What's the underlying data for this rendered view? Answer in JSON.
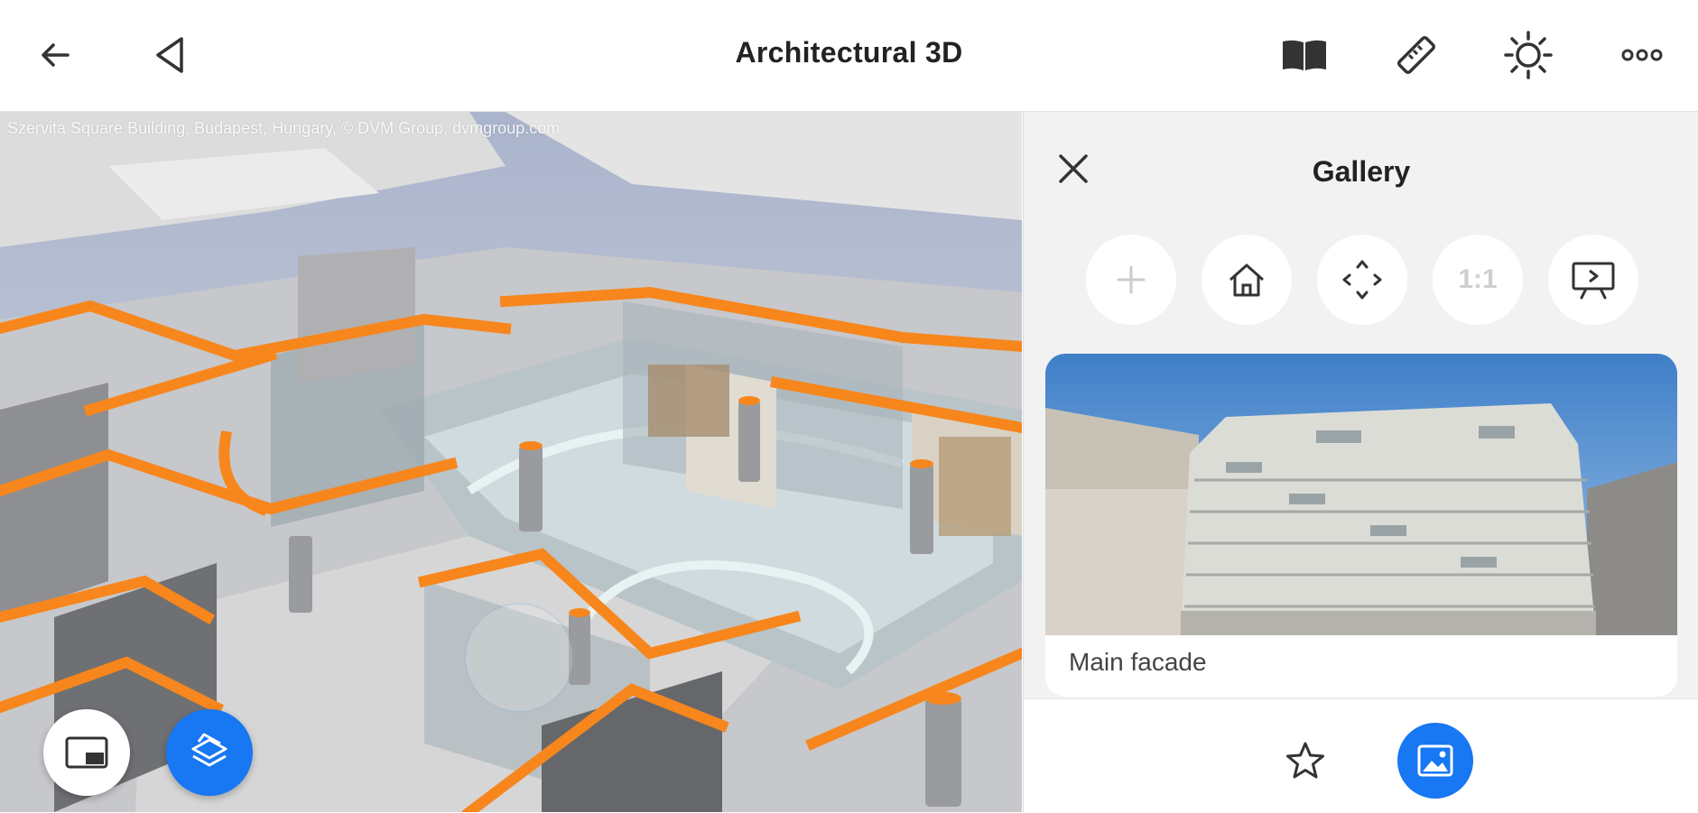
{
  "header": {
    "title": "Architectural 3D",
    "icons": [
      "back-arrow-icon",
      "triangle-back-icon",
      "book-icon",
      "ruler-icon",
      "sun-icon",
      "more-icon"
    ]
  },
  "viewport": {
    "credit": "Szervita Square Building, Budapest, Hungary, © DVM Group, dvmgroup.com",
    "buttons": [
      "picture-in-picture-icon",
      "model-layers-icon"
    ]
  },
  "panel": {
    "title": "Gallery",
    "toolbar": [
      "add-icon",
      "home-icon",
      "fit-view-icon",
      "1:1",
      "presentation-icon"
    ],
    "card_caption": "Main facade",
    "bottom_tabs": [
      "star-icon",
      "image-icon"
    ]
  },
  "colors": {
    "accent": "#1877f2",
    "wall_orange": "#f7861d"
  }
}
